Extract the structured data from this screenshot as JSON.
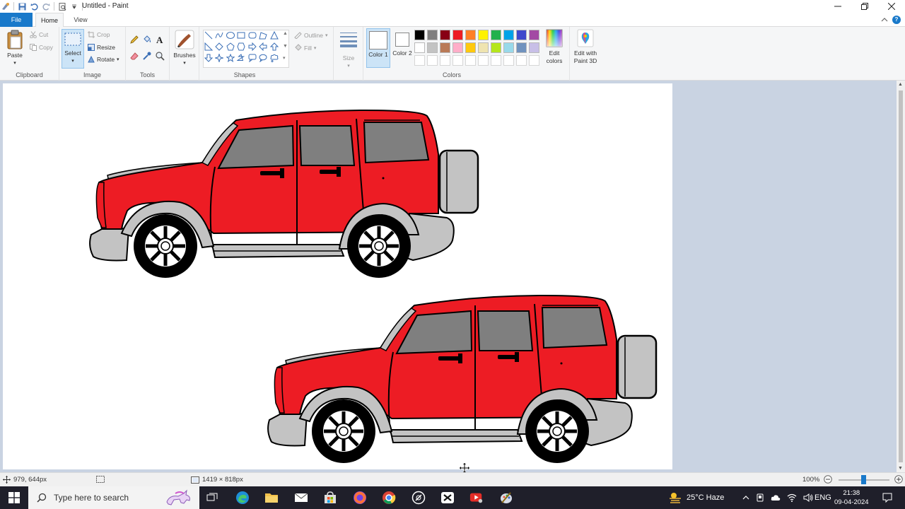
{
  "window": {
    "title": "Untitled - Paint"
  },
  "menu": {
    "tabs": [
      "File",
      "Home",
      "View"
    ],
    "active": "Home"
  },
  "ribbon": {
    "clipboard": {
      "paste": "Paste",
      "cut": "Cut",
      "copy": "Copy",
      "label": "Clipboard"
    },
    "image": {
      "select": "Select",
      "crop": "Crop",
      "resize": "Resize",
      "rotate": "Rotate",
      "label": "Image"
    },
    "tools": {
      "label": "Tools"
    },
    "brushes": {
      "label": "Brushes"
    },
    "shapes": {
      "outline": "Outline",
      "fill": "Fill",
      "label": "Shapes"
    },
    "size": {
      "label": "Size"
    },
    "colors": {
      "color1": "Color 1",
      "color2": "Color 2",
      "edit": "Edit colors",
      "paint3d": "Edit with Paint 3D",
      "label": "Colors",
      "color1_value": "#ffffff",
      "color2_value": "#ffffff",
      "palette_row1": [
        "#000000",
        "#7f7f7f",
        "#880015",
        "#ed1c24",
        "#ff7f27",
        "#fff200",
        "#22b14c",
        "#00a2e8",
        "#3f48cc",
        "#a349a4"
      ],
      "palette_row2": [
        "#ffffff",
        "#c3c3c3",
        "#b97a57",
        "#ffaec9",
        "#ffc90e",
        "#efe4b0",
        "#b5e61d",
        "#99d9ea",
        "#7092be",
        "#c8bfe7"
      ]
    }
  },
  "statusbar": {
    "cursor_pos": "979, 644px",
    "canvas_size": "1419 × 818px",
    "zoom": "100%"
  },
  "taskbar": {
    "search_placeholder": "Type here to search",
    "weather": "25°C  Haze",
    "language": "ENG",
    "time": "21:38",
    "date": "09-04-2024"
  },
  "colors": {
    "accent": "#1979ca",
    "car_body": "#ed1c24",
    "car_window": "#7f7f7f",
    "car_trim": "#c3c3c3"
  }
}
